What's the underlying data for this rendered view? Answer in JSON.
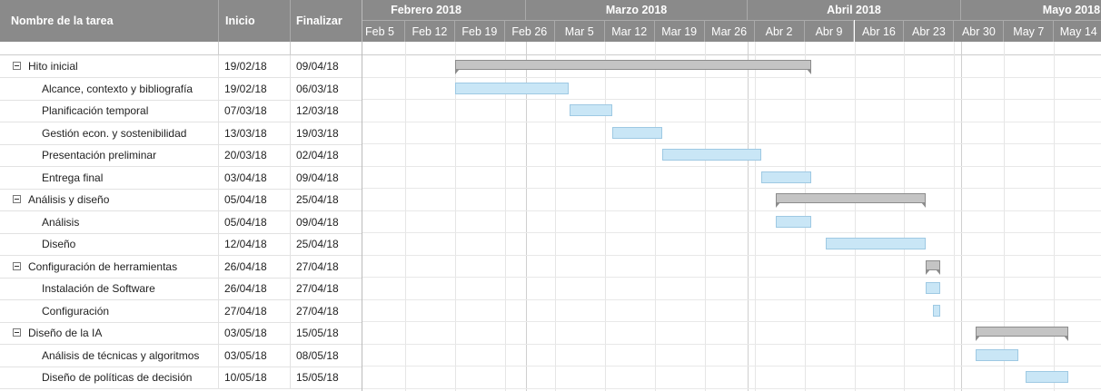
{
  "grid": {
    "headers": {
      "name": "Nombre de la tarea",
      "start": "Inicio",
      "end": "Finalizar"
    },
    "rows": [
      {
        "name": "Hito inicial",
        "start": "19/02/18",
        "end": "09/04/18",
        "summary": true
      },
      {
        "name": "Alcance, contexto y bibliografía",
        "start": "19/02/18",
        "end": "06/03/18",
        "summary": false
      },
      {
        "name": "Planificación temporal",
        "start": "07/03/18",
        "end": "12/03/18",
        "summary": false
      },
      {
        "name": "Gestión econ. y sostenibilidad",
        "start": "13/03/18",
        "end": "19/03/18",
        "summary": false
      },
      {
        "name": "Presentación preliminar",
        "start": "20/03/18",
        "end": "02/04/18",
        "summary": false
      },
      {
        "name": "Entrega final",
        "start": "03/04/18",
        "end": "09/04/18",
        "summary": false
      },
      {
        "name": "Análisis y diseño",
        "start": "05/04/18",
        "end": "25/04/18",
        "summary": true
      },
      {
        "name": "Análisis",
        "start": "05/04/18",
        "end": "09/04/18",
        "summary": false
      },
      {
        "name": "Diseño",
        "start": "12/04/18",
        "end": "25/04/18",
        "summary": false
      },
      {
        "name": "Configuración de herramientas",
        "start": "26/04/18",
        "end": "27/04/18",
        "summary": true
      },
      {
        "name": "Instalación de Software",
        "start": "26/04/18",
        "end": "27/04/18",
        "summary": false
      },
      {
        "name": "Configuración",
        "start": "27/04/18",
        "end": "27/04/18",
        "summary": false
      },
      {
        "name": "Diseño de la IA",
        "start": "03/05/18",
        "end": "15/05/18",
        "summary": true
      },
      {
        "name": "Análisis de técnicas y algoritmos",
        "start": "03/05/18",
        "end": "08/05/18",
        "summary": false
      },
      {
        "name": "Diseño de políticas de decisión",
        "start": "10/05/18",
        "end": "15/05/18",
        "summary": false
      }
    ]
  },
  "timeline": {
    "months": [
      "Febrero 2018",
      "Marzo 2018",
      "Abril 2018",
      "Mayo 2018"
    ],
    "weeks": [
      "Feb 5",
      "Feb 12",
      "Feb 19",
      "Feb 26",
      "Mar 5",
      "Mar 12",
      "Mar 19",
      "Mar 26",
      "Abr 2",
      "Abr 9",
      "Abr 16",
      "Abr 23",
      "Abr 30",
      "May 7",
      "May 14"
    ]
  },
  "colors": {
    "header_bg": "#8a8a8a",
    "task_bar": "#c9e6f6",
    "summary_bar": "#c4c4c4"
  }
}
